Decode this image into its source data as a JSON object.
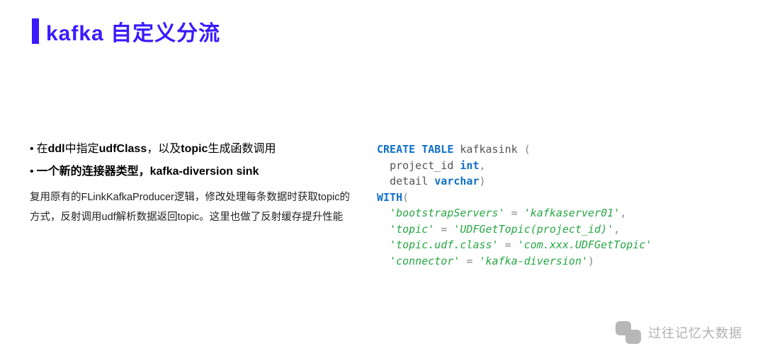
{
  "header": {
    "title": "kafka 自定义分流"
  },
  "left": {
    "bullet1_prefix": "在",
    "bullet1_b1": "ddl",
    "bullet1_mid1": "中指定",
    "bullet1_b2": "udfClass",
    "bullet1_mid2": "，以及",
    "bullet1_b3": "topic",
    "bullet1_suffix": "生成函数调用",
    "bullet2_prefix": "一个新的连接器类型，",
    "bullet2_b1": "kafka-diversion sink",
    "desc": "复用原有的FLinkKafkaProducer逻辑，修改处理每条数据时获取topic的方式，反射调用udf解析数据返回topic。这里也做了反射缓存提升性能"
  },
  "code": {
    "kw_create": "CREATE TABLE",
    "table_name": " kafkasink ",
    "lparen1": "(",
    "col1_name": "project_id ",
    "col1_type": "int",
    "comma1": ",",
    "col2_name": "detail ",
    "col2_type": "varchar",
    "rparen1": ")",
    "kw_with": "WITH",
    "lparen2": "(",
    "p1_key": "'bootstrapServers'",
    "eq": " = ",
    "p1_val": "'kafkaserver01'",
    "p2_key": "'topic'",
    "p2_val": "'UDFGetTopic(project_id)'",
    "p3_key": "'topic.udf.class'",
    "p3_val": "'com.xxx.UDFGetTopic'",
    "p4_key": "'connector'",
    "p4_val": "'kafka-diversion'",
    "rparen2": ")",
    "comma": ","
  },
  "watermark": {
    "text": "过往记忆大数据"
  }
}
